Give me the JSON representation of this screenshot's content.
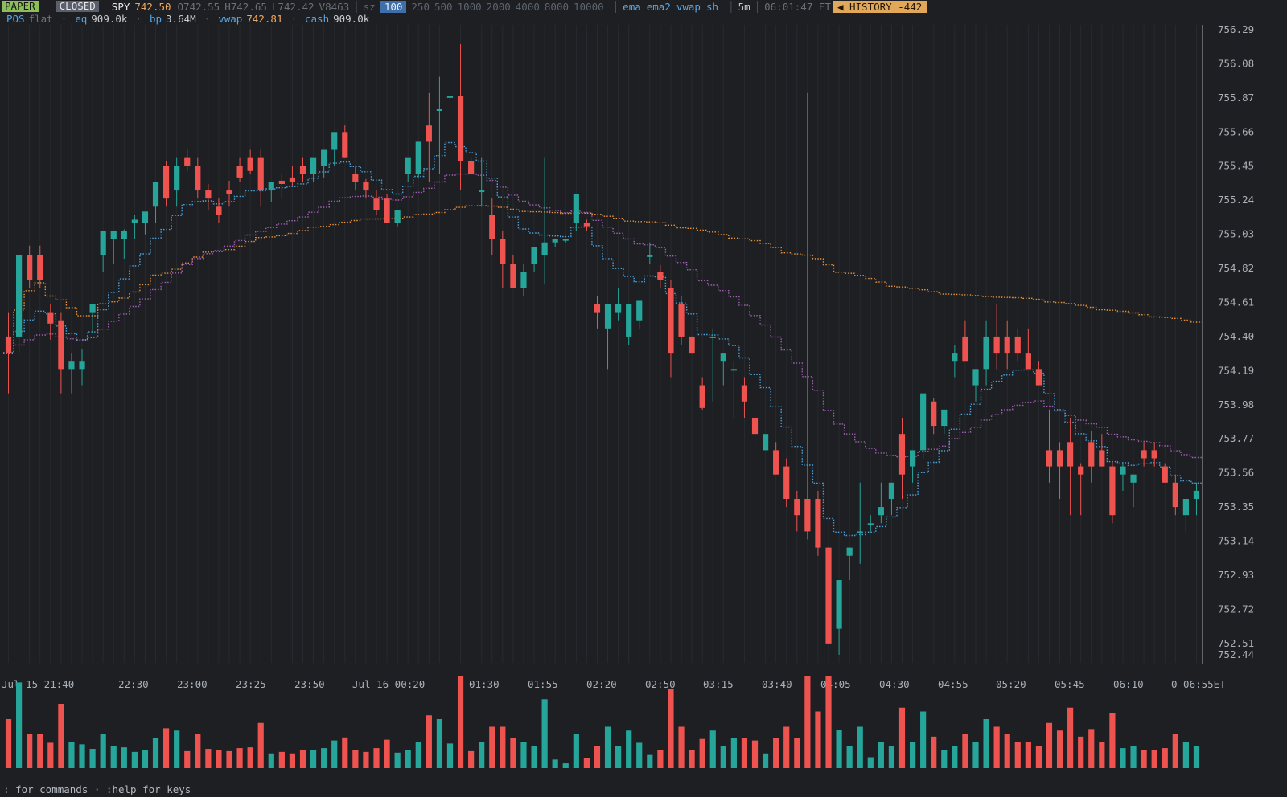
{
  "status": {
    "mode": "PAPER",
    "market_state": "CLOSED",
    "symbol": "SPY",
    "last": "742.50",
    "open": "O742.55",
    "high": "H742.65",
    "low": "L742.42",
    "volume": "V8463",
    "size_label": "sz",
    "sizes": [
      "100",
      "250",
      "500",
      "1000",
      "2000",
      "4000",
      "8000",
      "10000"
    ],
    "selected_size": "100",
    "indicators": [
      "ema",
      "ema2",
      "vwap",
      "sh"
    ],
    "timeframe": "5m",
    "clock": "06:01:47 ET",
    "history_badge": "◀ HISTORY -442"
  },
  "position": {
    "pos_label": "POS",
    "pos_value": "flat",
    "eq_label": "eq",
    "eq_value": "909.0k",
    "bp_label": "bp",
    "bp_value": "3.64M",
    "vwap_label": "vwap",
    "vwap_value": "742.81",
    "cash_label": "cash",
    "cash_value": "909.0k"
  },
  "footer": ": for commands · :help for keys",
  "colors": {
    "up": "#26a69a",
    "down": "#ef5350",
    "ema": "#4aa3df",
    "ema2": "#a25fb8",
    "vwap": "#e8913a",
    "background": "#1e1f22"
  },
  "chart_data": {
    "type": "candlestick",
    "interval": "5m",
    "y_ticks": [
      "756.29",
      "756.08",
      "755.87",
      "755.66",
      "755.45",
      "755.24",
      "755.03",
      "754.82",
      "754.61",
      "754.40",
      "754.19",
      "753.98",
      "753.77",
      "753.56",
      "753.35",
      "753.14",
      "752.93",
      "752.72",
      "752.51",
      "752.44"
    ],
    "ylim": [
      752.44,
      756.29
    ],
    "x_ticks": [
      "Jul 15 21:40",
      "22:30",
      "23:00",
      "23:25",
      "23:50",
      "Jul 16 00:20",
      "01:30",
      "01:55",
      "02:20",
      "02:50",
      "03:15",
      "03:40",
      "04:05",
      "04:30",
      "04:55",
      "05:20",
      "05:45",
      "06:10",
      "0 06:55ET"
    ],
    "candles": [
      {
        "o": 754.4,
        "h": 754.55,
        "l": 754.05,
        "c": 754.3
      },
      {
        "o": 754.4,
        "h": 754.88,
        "l": 754.3,
        "c": 754.9
      },
      {
        "o": 754.9,
        "h": 754.96,
        "l": 754.7,
        "c": 754.75
      },
      {
        "o": 754.9,
        "h": 754.96,
        "l": 754.7,
        "c": 754.75
      },
      {
        "o": 754.55,
        "h": 754.6,
        "l": 754.38,
        "c": 754.48
      },
      {
        "o": 754.5,
        "h": 754.55,
        "l": 754.05,
        "c": 754.2
      },
      {
        "o": 754.2,
        "h": 754.3,
        "l": 754.05,
        "c": 754.25
      },
      {
        "o": 754.2,
        "h": 754.32,
        "l": 754.1,
        "c": 754.25
      },
      {
        "o": 754.55,
        "h": 754.58,
        "l": 754.42,
        "c": 754.6
      },
      {
        "o": 754.9,
        "h": 755.05,
        "l": 754.8,
        "c": 755.05
      },
      {
        "o": 755.0,
        "h": 755.05,
        "l": 754.85,
        "c": 755.05
      },
      {
        "o": 755.0,
        "h": 755.06,
        "l": 754.88,
        "c": 755.05
      },
      {
        "o": 755.1,
        "h": 755.15,
        "l": 755.0,
        "c": 755.12
      },
      {
        "o": 755.1,
        "h": 755.16,
        "l": 755.03,
        "c": 755.17
      },
      {
        "o": 755.2,
        "h": 755.3,
        "l": 755.1,
        "c": 755.35
      },
      {
        "o": 755.45,
        "h": 755.48,
        "l": 755.2,
        "c": 755.25
      },
      {
        "o": 755.3,
        "h": 755.5,
        "l": 755.2,
        "c": 755.45
      },
      {
        "o": 755.5,
        "h": 755.55,
        "l": 755.42,
        "c": 755.45
      },
      {
        "o": 755.45,
        "h": 755.5,
        "l": 755.25,
        "c": 755.3
      },
      {
        "o": 755.3,
        "h": 755.34,
        "l": 755.18,
        "c": 755.25
      },
      {
        "o": 755.2,
        "h": 755.25,
        "l": 755.1,
        "c": 755.15
      },
      {
        "o": 755.3,
        "h": 755.36,
        "l": 755.2,
        "c": 755.28
      },
      {
        "o": 755.45,
        "h": 755.5,
        "l": 755.35,
        "c": 755.38
      },
      {
        "o": 755.5,
        "h": 755.55,
        "l": 755.4,
        "c": 755.42
      },
      {
        "o": 755.5,
        "h": 755.55,
        "l": 755.2,
        "c": 755.3
      },
      {
        "o": 755.3,
        "h": 755.33,
        "l": 755.23,
        "c": 755.35
      },
      {
        "o": 755.36,
        "h": 755.4,
        "l": 755.25,
        "c": 755.34
      },
      {
        "o": 755.38,
        "h": 755.45,
        "l": 755.33,
        "c": 755.35
      },
      {
        "o": 755.45,
        "h": 755.5,
        "l": 755.35,
        "c": 755.4
      },
      {
        "o": 755.4,
        "h": 755.45,
        "l": 755.35,
        "c": 755.5
      },
      {
        "o": 755.45,
        "h": 755.5,
        "l": 755.38,
        "c": 755.55
      },
      {
        "o": 755.55,
        "h": 755.66,
        "l": 755.45,
        "c": 755.66
      },
      {
        "o": 755.66,
        "h": 755.7,
        "l": 755.5,
        "c": 755.5
      },
      {
        "o": 755.4,
        "h": 755.45,
        "l": 755.3,
        "c": 755.35
      },
      {
        "o": 755.35,
        "h": 755.37,
        "l": 755.25,
        "c": 755.3
      },
      {
        "o": 755.25,
        "h": 755.3,
        "l": 755.15,
        "c": 755.18
      },
      {
        "o": 755.25,
        "h": 755.28,
        "l": 755.1,
        "c": 755.1
      },
      {
        "o": 755.1,
        "h": 755.16,
        "l": 755.08,
        "c": 755.18
      },
      {
        "o": 755.4,
        "h": 755.45,
        "l": 755.35,
        "c": 755.5
      },
      {
        "o": 755.4,
        "h": 755.48,
        "l": 755.38,
        "c": 755.6
      },
      {
        "o": 755.7,
        "h": 755.9,
        "l": 755.35,
        "c": 755.6
      },
      {
        "o": 755.8,
        "h": 756.0,
        "l": 755.4,
        "c": 755.8
      },
      {
        "o": 755.88,
        "h": 756.0,
        "l": 755.72,
        "c": 755.88
      },
      {
        "o": 755.88,
        "h": 756.2,
        "l": 755.3,
        "c": 755.48
      },
      {
        "o": 755.48,
        "h": 755.5,
        "l": 755.4,
        "c": 755.4
      },
      {
        "o": 755.3,
        "h": 755.5,
        "l": 755.2,
        "c": 755.3
      },
      {
        "o": 755.15,
        "h": 755.25,
        "l": 754.9,
        "c": 755.0
      },
      {
        "o": 755.0,
        "h": 755.05,
        "l": 754.7,
        "c": 754.85
      },
      {
        "o": 754.85,
        "h": 754.9,
        "l": 754.7,
        "c": 754.7
      },
      {
        "o": 754.7,
        "h": 754.85,
        "l": 754.65,
        "c": 754.8
      },
      {
        "o": 754.85,
        "h": 754.95,
        "l": 754.8,
        "c": 754.95
      },
      {
        "o": 754.9,
        "h": 755.5,
        "l": 754.72,
        "c": 754.98
      },
      {
        "o": 754.98,
        "h": 755.0,
        "l": 754.95,
        "c": 755.0
      },
      {
        "o": 755.0,
        "h": 755.0,
        "l": 754.98,
        "c": 755.0
      },
      {
        "o": 755.1,
        "h": 755.28,
        "l": 755.05,
        "c": 755.28
      },
      {
        "o": 755.1,
        "h": 755.12,
        "l": 755.05,
        "c": 755.08
      },
      {
        "o": 754.6,
        "h": 754.65,
        "l": 754.45,
        "c": 754.55
      },
      {
        "o": 754.45,
        "h": 754.55,
        "l": 754.2,
        "c": 754.6
      },
      {
        "o": 754.55,
        "h": 754.7,
        "l": 754.5,
        "c": 754.6
      },
      {
        "o": 754.4,
        "h": 754.6,
        "l": 754.35,
        "c": 754.6
      },
      {
        "o": 754.5,
        "h": 754.62,
        "l": 754.45,
        "c": 754.62
      },
      {
        "o": 754.9,
        "h": 754.98,
        "l": 754.85,
        "c": 754.9
      },
      {
        "o": 754.8,
        "h": 754.84,
        "l": 754.7,
        "c": 754.75
      },
      {
        "o": 754.7,
        "h": 754.75,
        "l": 754.15,
        "c": 754.3
      },
      {
        "o": 754.6,
        "h": 754.65,
        "l": 754.35,
        "c": 754.4
      },
      {
        "o": 754.4,
        "h": 754.4,
        "l": 754.3,
        "c": 754.3
      },
      {
        "o": 754.1,
        "h": 754.15,
        "l": 753.95,
        "c": 753.96
      },
      {
        "o": 754.4,
        "h": 754.45,
        "l": 754.0,
        "c": 754.4
      },
      {
        "o": 754.25,
        "h": 754.3,
        "l": 754.1,
        "c": 754.3
      },
      {
        "o": 754.2,
        "h": 754.25,
        "l": 753.9,
        "c": 754.2
      },
      {
        "o": 754.1,
        "h": 754.15,
        "l": 753.9,
        "c": 754.0
      },
      {
        "o": 753.9,
        "h": 753.92,
        "l": 753.7,
        "c": 753.8
      },
      {
        "o": 753.7,
        "h": 753.75,
        "l": 753.7,
        "c": 753.8
      },
      {
        "o": 753.7,
        "h": 753.75,
        "l": 753.55,
        "c": 753.55
      },
      {
        "o": 753.6,
        "h": 753.65,
        "l": 753.35,
        "c": 753.4
      },
      {
        "o": 753.4,
        "h": 753.45,
        "l": 753.2,
        "c": 753.3
      },
      {
        "o": 753.4,
        "h": 755.9,
        "l": 753.15,
        "c": 753.2
      },
      {
        "o": 753.4,
        "h": 753.45,
        "l": 753.05,
        "c": 753.1
      },
      {
        "o": 753.1,
        "h": 753.1,
        "l": 752.51,
        "c": 752.51
      },
      {
        "o": 752.6,
        "h": 752.6,
        "l": 752.44,
        "c": 752.9
      },
      {
        "o": 753.05,
        "h": 753.1,
        "l": 752.9,
        "c": 753.1
      },
      {
        "o": 753.2,
        "h": 753.5,
        "l": 753.0,
        "c": 753.2
      },
      {
        "o": 753.25,
        "h": 753.3,
        "l": 753.2,
        "c": 753.25
      },
      {
        "o": 753.3,
        "h": 753.5,
        "l": 753.25,
        "c": 753.35
      },
      {
        "o": 753.4,
        "h": 753.45,
        "l": 753.3,
        "c": 753.5
      },
      {
        "o": 753.8,
        "h": 753.9,
        "l": 753.4,
        "c": 753.55
      },
      {
        "o": 753.6,
        "h": 753.7,
        "l": 753.5,
        "c": 753.7
      },
      {
        "o": 753.7,
        "h": 754.0,
        "l": 753.65,
        "c": 754.05
      },
      {
        "o": 754.0,
        "h": 754.02,
        "l": 753.8,
        "c": 753.85
      },
      {
        "o": 753.85,
        "h": 753.9,
        "l": 753.8,
        "c": 753.95
      },
      {
        "o": 754.25,
        "h": 754.35,
        "l": 754.15,
        "c": 754.3
      },
      {
        "o": 754.4,
        "h": 754.5,
        "l": 754.25,
        "c": 754.25
      },
      {
        "o": 754.1,
        "h": 754.2,
        "l": 754.0,
        "c": 754.2
      },
      {
        "o": 754.2,
        "h": 754.5,
        "l": 754.1,
        "c": 754.4
      },
      {
        "o": 754.4,
        "h": 754.6,
        "l": 754.2,
        "c": 754.3
      },
      {
        "o": 754.4,
        "h": 754.5,
        "l": 754.2,
        "c": 754.3
      },
      {
        "o": 754.4,
        "h": 754.45,
        "l": 754.25,
        "c": 754.3
      },
      {
        "o": 754.3,
        "h": 754.45,
        "l": 754.25,
        "c": 754.2
      },
      {
        "o": 754.2,
        "h": 754.25,
        "l": 754.1,
        "c": 754.1
      },
      {
        "o": 753.7,
        "h": 753.95,
        "l": 753.5,
        "c": 753.6
      },
      {
        "o": 753.7,
        "h": 753.75,
        "l": 753.4,
        "c": 753.6
      },
      {
        "o": 753.75,
        "h": 753.9,
        "l": 753.3,
        "c": 753.6
      },
      {
        "o": 753.6,
        "h": 753.62,
        "l": 753.3,
        "c": 753.55
      },
      {
        "o": 753.75,
        "h": 753.82,
        "l": 753.5,
        "c": 753.6
      },
      {
        "o": 753.7,
        "h": 753.8,
        "l": 753.6,
        "c": 753.6
      },
      {
        "o": 753.6,
        "h": 753.63,
        "l": 753.25,
        "c": 753.3
      },
      {
        "o": 753.55,
        "h": 753.62,
        "l": 753.45,
        "c": 753.6
      },
      {
        "o": 753.5,
        "h": 753.55,
        "l": 753.35,
        "c": 753.55
      },
      {
        "o": 753.7,
        "h": 753.75,
        "l": 753.6,
        "c": 753.65
      },
      {
        "o": 753.7,
        "h": 753.75,
        "l": 753.6,
        "c": 753.65
      },
      {
        "o": 753.6,
        "h": 753.62,
        "l": 753.5,
        "c": 753.5
      },
      {
        "o": 753.5,
        "h": 753.55,
        "l": 753.3,
        "c": 753.35
      },
      {
        "o": 753.3,
        "h": 753.4,
        "l": 753.2,
        "c": 753.4
      },
      {
        "o": 753.4,
        "h": 753.5,
        "l": 753.3,
        "c": 753.45
      }
    ]
  }
}
